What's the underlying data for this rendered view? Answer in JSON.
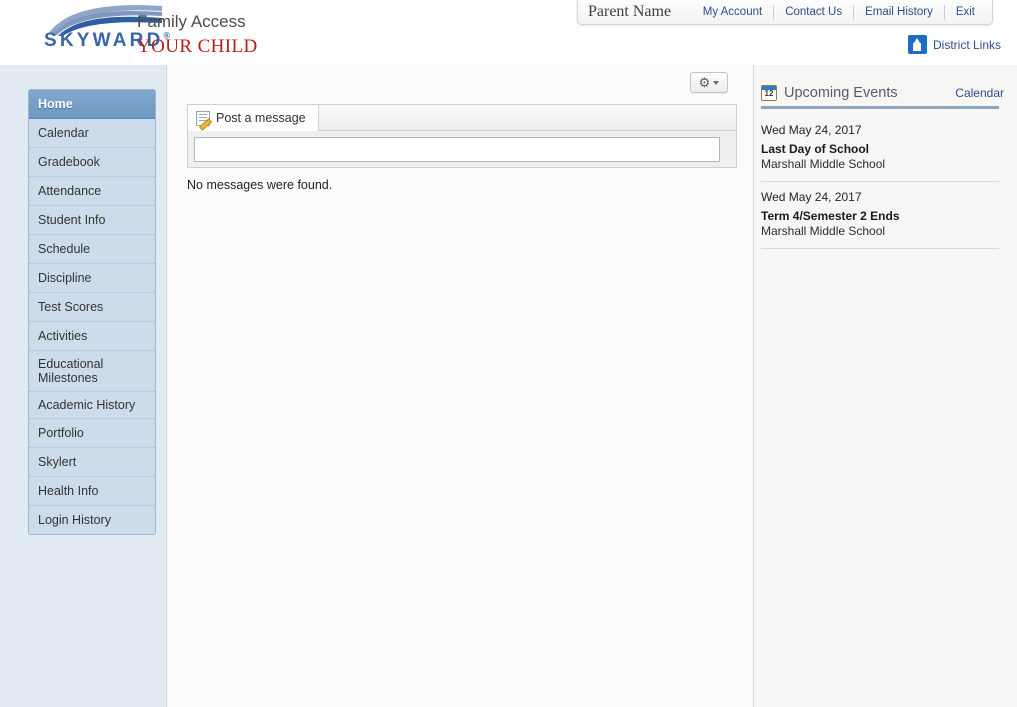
{
  "header": {
    "brand_word": "SKYWARD",
    "brand_reg": "®",
    "product_title": "Family Access",
    "student_name": "YOUR CHILD",
    "logo_icon": "skyward-swoosh-logo"
  },
  "topnav": {
    "parent_name": "Parent Name",
    "links": [
      {
        "label": "My Account",
        "name": "my-account"
      },
      {
        "label": "Contact Us",
        "name": "contact-us"
      },
      {
        "label": "Email History",
        "name": "email-history"
      },
      {
        "label": "Exit",
        "name": "exit"
      }
    ]
  },
  "district_links": {
    "label": "District Links",
    "icon": "school-building-icon"
  },
  "sidebar": {
    "items": [
      {
        "label": "Home",
        "active": true
      },
      {
        "label": "Calendar",
        "active": false
      },
      {
        "label": "Gradebook",
        "active": false
      },
      {
        "label": "Attendance",
        "active": false
      },
      {
        "label": "Student Info",
        "active": false
      },
      {
        "label": "Schedule",
        "active": false
      },
      {
        "label": "Discipline",
        "active": false
      },
      {
        "label": "Test Scores",
        "active": false
      },
      {
        "label": "Activities",
        "active": false
      },
      {
        "label": "Educational Milestones",
        "active": false
      },
      {
        "label": "Academic History",
        "active": false
      },
      {
        "label": "Portfolio",
        "active": false
      },
      {
        "label": "Skylert",
        "active": false
      },
      {
        "label": "Health Info",
        "active": false
      },
      {
        "label": "Login History",
        "active": false
      }
    ]
  },
  "main": {
    "gear_icon": "gear-icon",
    "gear_caret": "chevron-down-icon",
    "post_tab_label": "Post a message",
    "post_tab_icon": "note-pencil-icon",
    "message_input_value": "",
    "message_input_placeholder": "",
    "empty_message": "No messages were found."
  },
  "events_panel": {
    "title": "Upcoming Events",
    "title_icon": "calendar-icon",
    "calendar_icon_day": "12",
    "calendar_link": "Calendar",
    "events": [
      {
        "date": "Wed May 24, 2017",
        "title": "Last Day of School",
        "school": "Marshall Middle School"
      },
      {
        "date": "Wed May 24, 2017",
        "title": "Term 4/Semester 2 Ends",
        "school": "Marshall Middle School"
      }
    ]
  },
  "colors": {
    "brand_blue": "#3a66a8",
    "accent_red": "#b81d1d",
    "link_blue": "#2b4f8e",
    "sidebar_bg": "#e2eaf4",
    "active_item": "#6d99c3"
  }
}
